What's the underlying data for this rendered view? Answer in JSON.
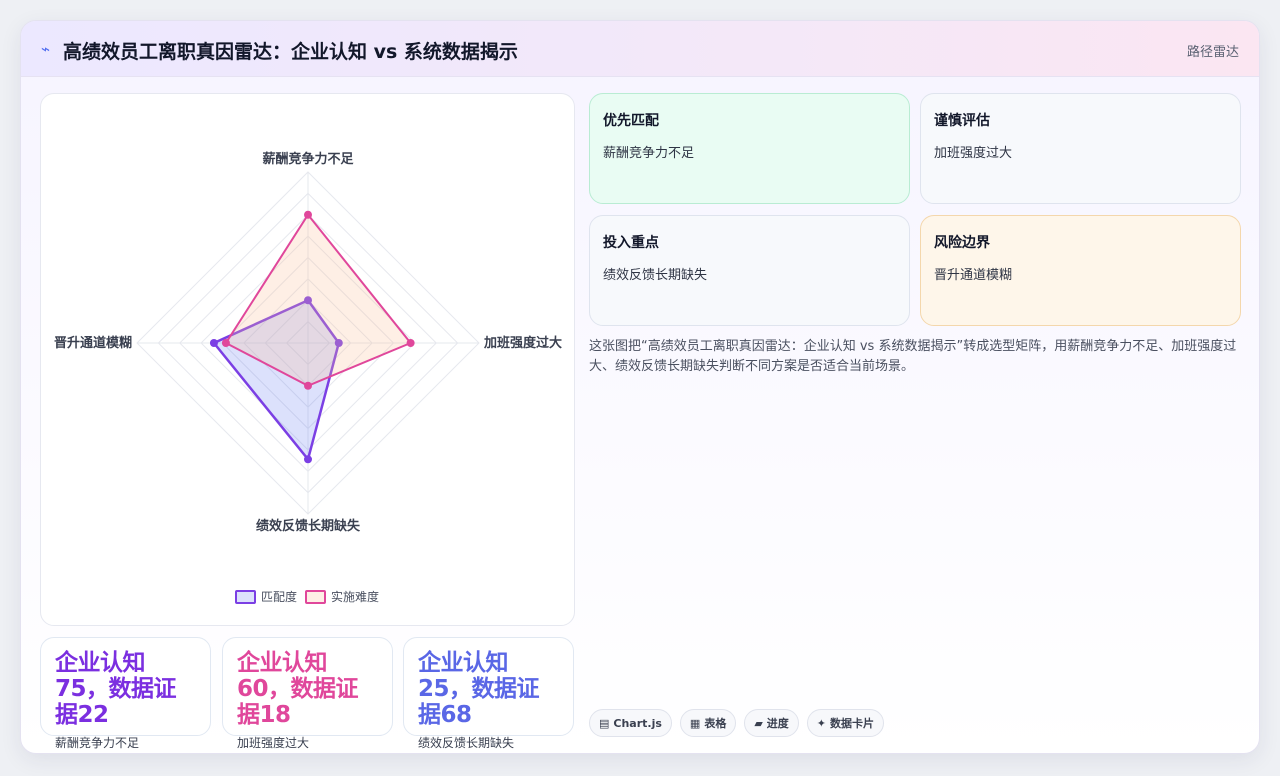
{
  "header": {
    "icon": "chart-icon",
    "title": "高绩效员工离职真因雷达：企业认知 vs 系统数据揭示",
    "right_label": "路径雷达"
  },
  "chart_data": {
    "type": "radar",
    "axes": [
      "薪酬竞争力不足",
      "加班强度过大",
      "绩效反馈长期缺失",
      "晋升通道模糊"
    ],
    "series": [
      {
        "name": "匹配度",
        "values": [
          25,
          18,
          68,
          55
        ],
        "color": "#7b3fe4"
      },
      {
        "name": "实施难度",
        "values": [
          75,
          60,
          25,
          48
        ],
        "color": "#e0479b"
      }
    ],
    "rlim": [
      0,
      100
    ],
    "grid": true,
    "legend": "bottom"
  },
  "kpis": [
    {
      "value": "企业认知75，数据证据22",
      "label": "薪酬竞争力不足",
      "color": "#7b2fe0"
    },
    {
      "value": "企业认知60，数据证据18",
      "label": "加班强度过大",
      "color": "#e0479b"
    },
    {
      "value": "企业认知25，数据证据68",
      "label": "绩效反馈长期缺失",
      "color": "#5a67e6"
    }
  ],
  "matrix": [
    {
      "title": "优先匹配",
      "value": "薪酬竞争力不足",
      "bg": "#e9fcf3",
      "border": "#b9ecd3"
    },
    {
      "title": "谨慎评估",
      "value": "加班强度过大",
      "bg": "#f7f9fc",
      "border": "#dfe4ee"
    },
    {
      "title": "投入重点",
      "value": "绩效反馈长期缺失",
      "bg": "#f7f9fc",
      "border": "#dfe4ee"
    },
    {
      "title": "风险边界",
      "value": "晋升通道模糊",
      "bg": "#fef6ea",
      "border": "#f4d7ac"
    }
  ],
  "description": "这张图把“高绩效员工离职真因雷达：企业认知 vs 系统数据揭示”转成选型矩阵，用薪酬竞争力不足、加班强度过大、绩效反馈长期缺失判断不同方案是否适合当前场景。",
  "tags": [
    {
      "icon": "▤",
      "label": "Chart.js"
    },
    {
      "icon": "▦",
      "label": "表格"
    },
    {
      "icon": "▰",
      "label": "进度"
    },
    {
      "icon": "✦",
      "label": "数据卡片"
    }
  ]
}
